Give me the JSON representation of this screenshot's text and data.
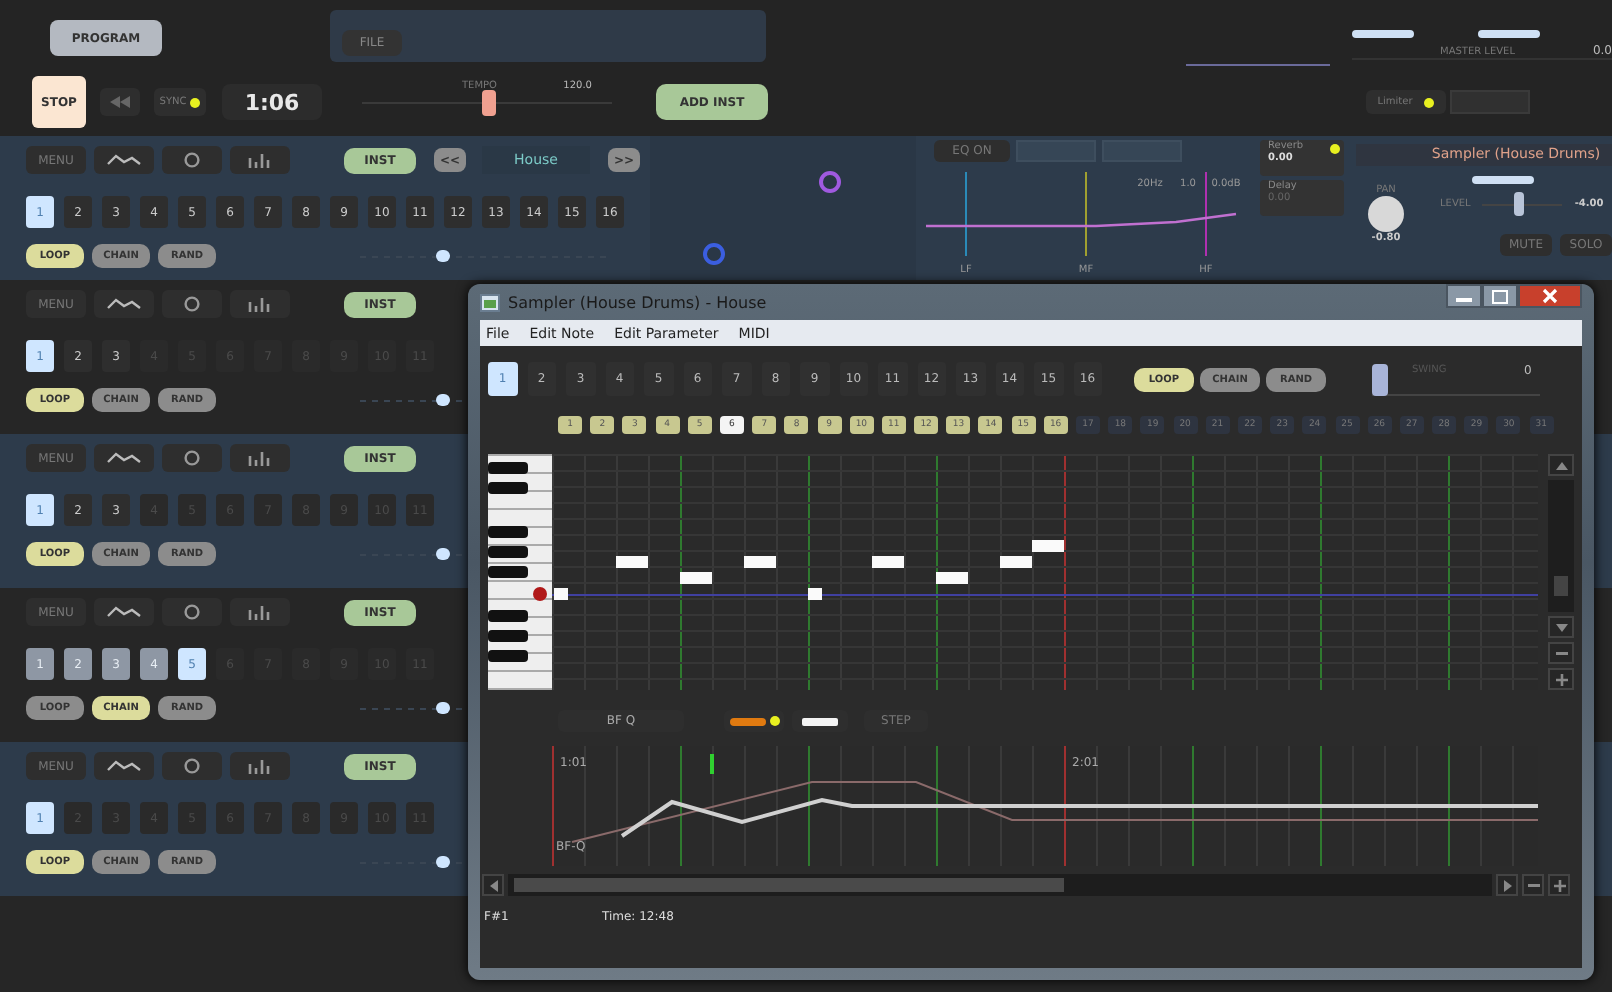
{
  "toolbar": {
    "program_button": "PROGRAM",
    "file_button": "FILE"
  },
  "transport": {
    "stop": "STOP",
    "sync": {
      "label": "SYNC",
      "on": true
    },
    "time": "1:06",
    "tempo": {
      "label": "TEMPO",
      "level": 0.5,
      "value": "120.0"
    },
    "add_instrument": "ADD INST"
  },
  "master": {
    "label": "MASTER LEVEL",
    "value": "0.0",
    "limiter": {
      "label": "Limiter",
      "on": true
    }
  },
  "tracks": [
    {
      "menu": "MENU",
      "inst": "INST",
      "preset": {
        "prev": "<<",
        "name": "House",
        "next": ">>"
      },
      "patterns": [
        {
          "label": "1",
          "selected": true,
          "enabled": true,
          "in_chain": false
        },
        {
          "label": "2",
          "selected": false,
          "enabled": true,
          "in_chain": false
        },
        {
          "label": "3",
          "selected": false,
          "enabled": true,
          "in_chain": false
        },
        {
          "label": "4",
          "selected": false,
          "enabled": true,
          "in_chain": false
        },
        {
          "label": "5",
          "selected": false,
          "enabled": true,
          "in_chain": false
        },
        {
          "label": "6",
          "selected": false,
          "enabled": true,
          "in_chain": false
        },
        {
          "label": "7",
          "selected": false,
          "enabled": true,
          "in_chain": false
        },
        {
          "label": "8",
          "selected": false,
          "enabled": true,
          "in_chain": false
        },
        {
          "label": "9",
          "selected": false,
          "enabled": true,
          "in_chain": false
        },
        {
          "label": "10",
          "selected": false,
          "enabled": true,
          "in_chain": false
        },
        {
          "label": "11",
          "selected": false,
          "enabled": true,
          "in_chain": false
        },
        {
          "label": "12",
          "selected": false,
          "enabled": true,
          "in_chain": false
        },
        {
          "label": "13",
          "selected": false,
          "enabled": true,
          "in_chain": false
        },
        {
          "label": "14",
          "selected": false,
          "enabled": true,
          "in_chain": false
        },
        {
          "label": "15",
          "selected": false,
          "enabled": true,
          "in_chain": false
        },
        {
          "label": "16",
          "selected": false,
          "enabled": true,
          "in_chain": false
        }
      ],
      "modes": [
        {
          "label": "LOOP",
          "selected": true
        },
        {
          "label": "CHAIN",
          "selected": false
        },
        {
          "label": "RAND",
          "selected": false
        }
      ]
    },
    {
      "menu": "MENU",
      "inst": "INST",
      "patterns": [
        {
          "label": "1",
          "selected": true,
          "enabled": true,
          "in_chain": false
        },
        {
          "label": "2",
          "selected": false,
          "enabled": true,
          "in_chain": false
        },
        {
          "label": "3",
          "selected": false,
          "enabled": true,
          "in_chain": false
        },
        {
          "label": "4",
          "selected": false,
          "enabled": false,
          "in_chain": false
        },
        {
          "label": "5",
          "selected": false,
          "enabled": false,
          "in_chain": false
        },
        {
          "label": "6",
          "selected": false,
          "enabled": false,
          "in_chain": false
        },
        {
          "label": "7",
          "selected": false,
          "enabled": false,
          "in_chain": false
        },
        {
          "label": "8",
          "selected": false,
          "enabled": false,
          "in_chain": false
        },
        {
          "label": "9",
          "selected": false,
          "enabled": false,
          "in_chain": false
        },
        {
          "label": "10",
          "selected": false,
          "enabled": false,
          "in_chain": false
        },
        {
          "label": "11",
          "selected": false,
          "enabled": false,
          "in_chain": false
        }
      ],
      "modes": [
        {
          "label": "LOOP",
          "selected": true
        },
        {
          "label": "CHAIN",
          "selected": false
        },
        {
          "label": "RAND",
          "selected": false
        }
      ]
    },
    {
      "menu": "MENU",
      "inst": "INST",
      "patterns": [
        {
          "label": "1",
          "selected": true,
          "enabled": true,
          "in_chain": false
        },
        {
          "label": "2",
          "selected": false,
          "enabled": true,
          "in_chain": false
        },
        {
          "label": "3",
          "selected": false,
          "enabled": true,
          "in_chain": false
        },
        {
          "label": "4",
          "selected": false,
          "enabled": false,
          "in_chain": false
        },
        {
          "label": "5",
          "selected": false,
          "enabled": false,
          "in_chain": false
        },
        {
          "label": "6",
          "selected": false,
          "enabled": false,
          "in_chain": false
        },
        {
          "label": "7",
          "selected": false,
          "enabled": false,
          "in_chain": false
        },
        {
          "label": "8",
          "selected": false,
          "enabled": false,
          "in_chain": false
        },
        {
          "label": "9",
          "selected": false,
          "enabled": false,
          "in_chain": false
        },
        {
          "label": "10",
          "selected": false,
          "enabled": false,
          "in_chain": false
        },
        {
          "label": "11",
          "selected": false,
          "enabled": false,
          "in_chain": false
        }
      ],
      "modes": [
        {
          "label": "LOOP",
          "selected": true
        },
        {
          "label": "CHAIN",
          "selected": false
        },
        {
          "label": "RAND",
          "selected": false
        }
      ]
    },
    {
      "menu": "MENU",
      "inst": "INST",
      "patterns": [
        {
          "label": "1",
          "selected": false,
          "enabled": true,
          "in_chain": true
        },
        {
          "label": "2",
          "selected": false,
          "enabled": true,
          "in_chain": true
        },
        {
          "label": "3",
          "selected": false,
          "enabled": true,
          "in_chain": true
        },
        {
          "label": "4",
          "selected": false,
          "enabled": true,
          "in_chain": true
        },
        {
          "label": "5",
          "selected": true,
          "enabled": true,
          "in_chain": false
        },
        {
          "label": "6",
          "selected": false,
          "enabled": false,
          "in_chain": false
        },
        {
          "label": "7",
          "selected": false,
          "enabled": false,
          "in_chain": false
        },
        {
          "label": "8",
          "selected": false,
          "enabled": false,
          "in_chain": false
        },
        {
          "label": "9",
          "selected": false,
          "enabled": false,
          "in_chain": false
        },
        {
          "label": "10",
          "selected": false,
          "enabled": false,
          "in_chain": false
        },
        {
          "label": "11",
          "selected": false,
          "enabled": false,
          "in_chain": false
        }
      ],
      "modes": [
        {
          "label": "LOOP",
          "selected": false
        },
        {
          "label": "CHAIN",
          "selected": true
        },
        {
          "label": "RAND",
          "selected": false
        }
      ]
    },
    {
      "menu": "MENU",
      "inst": "INST",
      "patterns": [
        {
          "label": "1",
          "selected": true,
          "enabled": true,
          "in_chain": false
        },
        {
          "label": "2",
          "selected": false,
          "enabled": false,
          "in_chain": false
        },
        {
          "label": "3",
          "selected": false,
          "enabled": false,
          "in_chain": false
        },
        {
          "label": "4",
          "selected": false,
          "enabled": false,
          "in_chain": false
        },
        {
          "label": "5",
          "selected": false,
          "enabled": false,
          "in_chain": false
        },
        {
          "label": "6",
          "selected": false,
          "enabled": false,
          "in_chain": false
        },
        {
          "label": "7",
          "selected": false,
          "enabled": false,
          "in_chain": false
        },
        {
          "label": "8",
          "selected": false,
          "enabled": false,
          "in_chain": false
        },
        {
          "label": "9",
          "selected": false,
          "enabled": false,
          "in_chain": false
        },
        {
          "label": "10",
          "selected": false,
          "enabled": false,
          "in_chain": false
        },
        {
          "label": "11",
          "selected": false,
          "enabled": false,
          "in_chain": false
        }
      ],
      "modes": [
        {
          "label": "LOOP",
          "selected": true
        },
        {
          "label": "CHAIN",
          "selected": false
        },
        {
          "label": "RAND",
          "selected": false
        }
      ]
    }
  ],
  "effects": {
    "eq": {
      "button": "EQ ON",
      "readouts": [
        "20Hz",
        "1.0",
        "0.0dB"
      ],
      "bands": [
        "LF",
        "MF",
        "HF"
      ]
    },
    "sends": [
      {
        "label": "Reverb",
        "value": "0.00",
        "on": true
      },
      {
        "label": "Delay",
        "value": "0.00",
        "on": false
      }
    ],
    "instrument": {
      "title": "Sampler (House Drums)",
      "pan": {
        "label": "PAN",
        "value": "-0.80"
      },
      "level": {
        "label": "LEVEL",
        "value": "-4.00",
        "level": 0.45
      },
      "mute": "MUTE",
      "solo": "SOLO"
    }
  },
  "editor": {
    "title": "Sampler (House Drums) - House",
    "menu": [
      "File",
      "Edit Note",
      "Edit Parameter",
      "MIDI"
    ],
    "patterns": [
      {
        "label": "1",
        "selected": true
      },
      {
        "label": "2",
        "selected": false
      },
      {
        "label": "3",
        "selected": false
      },
      {
        "label": "4",
        "selected": false
      },
      {
        "label": "5",
        "selected": false
      },
      {
        "label": "6",
        "selected": false
      },
      {
        "label": "7",
        "selected": false
      },
      {
        "label": "8",
        "selected": false
      },
      {
        "label": "9",
        "selected": false
      },
      {
        "label": "10",
        "selected": false
      },
      {
        "label": "11",
        "selected": false
      },
      {
        "label": "12",
        "selected": false
      },
      {
        "label": "13",
        "selected": false
      },
      {
        "label": "14",
        "selected": false
      },
      {
        "label": "15",
        "selected": false
      },
      {
        "label": "16",
        "selected": false
      }
    ],
    "modes": [
      {
        "label": "LOOP",
        "selected": true
      },
      {
        "label": "CHAIN",
        "selected": false
      },
      {
        "label": "RAND",
        "selected": false
      }
    ],
    "swing": {
      "label": "SWING",
      "value": "0",
      "level": 0
    },
    "steps": [
      {
        "label": "1",
        "active": true,
        "selected": false
      },
      {
        "label": "2",
        "active": true,
        "selected": false
      },
      {
        "label": "3",
        "active": true,
        "selected": false
      },
      {
        "label": "4",
        "active": true,
        "selected": false
      },
      {
        "label": "5",
        "active": true,
        "selected": false
      },
      {
        "label": "6",
        "active": true,
        "selected": true
      },
      {
        "label": "7",
        "active": true,
        "selected": false
      },
      {
        "label": "8",
        "active": true,
        "selected": false
      },
      {
        "label": "9",
        "active": true,
        "selected": false
      },
      {
        "label": "10",
        "active": true,
        "selected": false
      },
      {
        "label": "11",
        "active": true,
        "selected": false
      },
      {
        "label": "12",
        "active": true,
        "selected": false
      },
      {
        "label": "13",
        "active": true,
        "selected": false
      },
      {
        "label": "14",
        "active": true,
        "selected": false
      },
      {
        "label": "15",
        "active": true,
        "selected": false
      },
      {
        "label": "16",
        "active": true,
        "selected": false
      },
      {
        "label": "17",
        "active": false,
        "selected": false
      },
      {
        "label": "18",
        "active": false,
        "selected": false
      },
      {
        "label": "19",
        "active": false,
        "selected": false
      },
      {
        "label": "20",
        "active": false,
        "selected": false
      },
      {
        "label": "21",
        "active": false,
        "selected": false
      },
      {
        "label": "22",
        "active": false,
        "selected": false
      },
      {
        "label": "23",
        "active": false,
        "selected": false
      },
      {
        "label": "24",
        "active": false,
        "selected": false
      },
      {
        "label": "25",
        "active": false,
        "selected": false
      },
      {
        "label": "26",
        "active": false,
        "selected": false
      },
      {
        "label": "27",
        "active": false,
        "selected": false
      },
      {
        "label": "28",
        "active": false,
        "selected": false
      },
      {
        "label": "29",
        "active": false,
        "selected": false
      },
      {
        "label": "30",
        "active": false,
        "selected": false
      },
      {
        "label": "31",
        "active": false,
        "selected": false
      }
    ],
    "parameter": {
      "name": "BF Q",
      "color_toggle_on": true,
      "step": "STEP"
    },
    "automation": {
      "markers": [
        "1:01",
        "2:01"
      ],
      "curve_label": "BF-Q"
    },
    "status": {
      "note": "F#1",
      "time": "Time: 12:48"
    }
  }
}
